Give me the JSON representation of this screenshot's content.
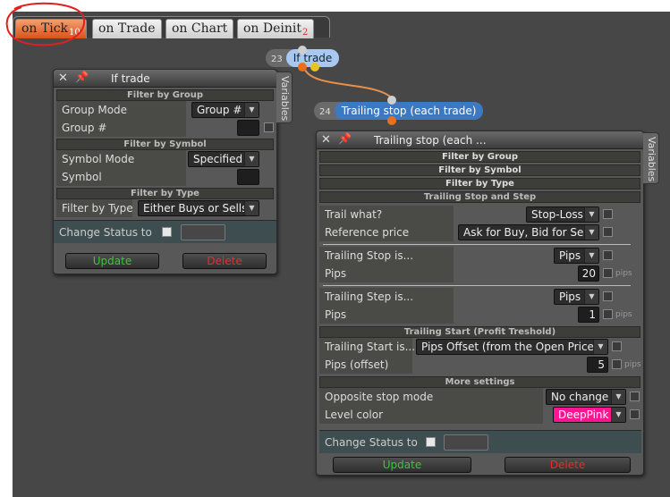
{
  "tabs": [
    {
      "label": "on Tick",
      "badge": "10",
      "active": true
    },
    {
      "label": "on Trade",
      "badge": "",
      "active": false
    },
    {
      "label": "on Chart",
      "badge": "",
      "active": false
    },
    {
      "label": "on Deinit",
      "badge": "2",
      "active": false
    }
  ],
  "nodes": {
    "n23": {
      "number": "23",
      "label": "If trade"
    },
    "n24": {
      "number": "24",
      "label": "Trailing stop (each trade)"
    }
  },
  "panel_if": {
    "title": "If trade",
    "vtab": "Variables",
    "sec_group": "Filter by Group",
    "group_mode_label": "Group Mode",
    "group_mode_value": "Group #",
    "group_num_label": "Group #",
    "sec_symbol": "Filter by Symbol",
    "symbol_mode_label": "Symbol Mode",
    "symbol_mode_value": "Specified",
    "symbol_label": "Symbol",
    "sec_type": "Filter by Type",
    "type_label": "Filter by Type",
    "type_value": "Either Buys or Sells",
    "change_status": "Change Status to",
    "update": "Update",
    "delete": "Delete"
  },
  "panel_trail": {
    "title": "Trailing stop (each ...",
    "vtab": "Variables",
    "sec_group": "Filter by Group",
    "sec_symbol": "Filter by Symbol",
    "sec_type": "Filter by Type",
    "sec_trail": "Trailing Stop and Step",
    "trail_what_label": "Trail what?",
    "trail_what_value": "Stop-Loss",
    "ref_price_label": "Reference price",
    "ref_price_value": "Ask for Buy, Bid for Sell",
    "stop_is_label": "Trailing Stop is...",
    "stop_is_value": "Pips",
    "stop_pips_label": "Pips",
    "stop_pips_value": "20",
    "step_is_label": "Trailing Step is...",
    "step_is_value": "Pips",
    "step_pips_label": "Pips",
    "step_pips_value": "1",
    "pips_unit": "pips",
    "sec_start": "Trailing Start (Profit Treshold)",
    "start_is_label": "Trailing Start is...",
    "start_is_value": "Pips Offset (from the Open Price)",
    "start_pips_label": "Pips (offset)",
    "start_pips_value": "5",
    "sec_more": "More settings",
    "opp_label": "Opposite stop mode",
    "opp_value": "No change",
    "color_label": "Level color",
    "color_value": "DeepPink",
    "change_status": "Change Status to",
    "update": "Update",
    "delete": "Delete"
  },
  "colors": {
    "active_tab": "#e0652b",
    "node_if": "#a9c8ef",
    "node_trail": "#3d79c1",
    "deeppink": "#ff1493",
    "update": "#39c839",
    "delete": "#e03030",
    "annotation": "#e02020"
  }
}
